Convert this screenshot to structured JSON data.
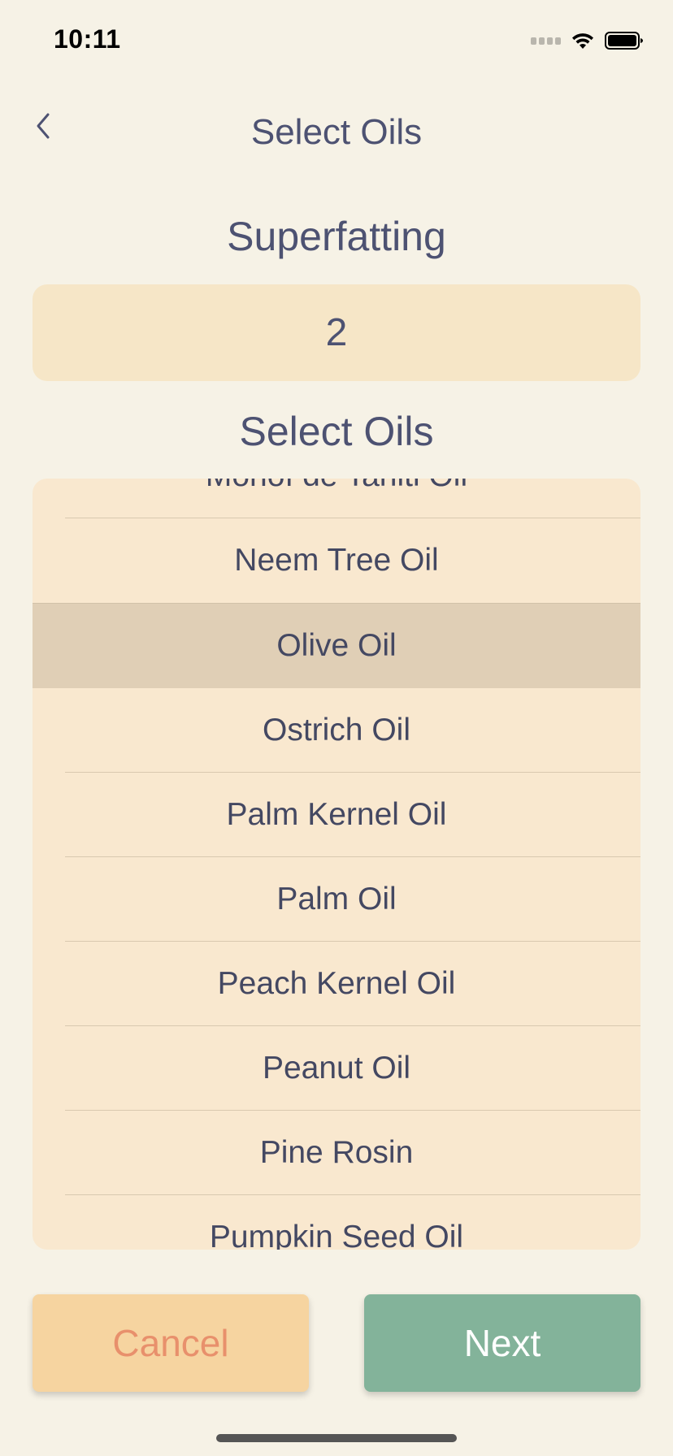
{
  "status_bar": {
    "time": "10:11"
  },
  "nav": {
    "title": "Select Oils",
    "back_icon": "chevron-left-icon"
  },
  "superfatting": {
    "label": "Superfatting",
    "value": "2"
  },
  "oils": {
    "label": "Select Oils",
    "selected_index": 2,
    "items": [
      "Monoï de Tahiti Oil",
      "Neem Tree Oil",
      "Olive Oil",
      "Ostrich Oil",
      "Palm Kernel Oil",
      "Palm Oil",
      "Peach Kernel Oil",
      "Peanut Oil",
      "Pine Rosin",
      "Pumpkin Seed Oil"
    ]
  },
  "buttons": {
    "cancel": "Cancel",
    "next": "Next"
  },
  "colors": {
    "background": "#f6f2e6",
    "field": "#f6e6c7",
    "picker": "#f9e8cf",
    "picker_selected": "#e0cfb6",
    "cancel_bg": "#f6d4a0",
    "cancel_text": "#e8906c",
    "next_bg": "#83b39a",
    "text": "#4d5272"
  }
}
